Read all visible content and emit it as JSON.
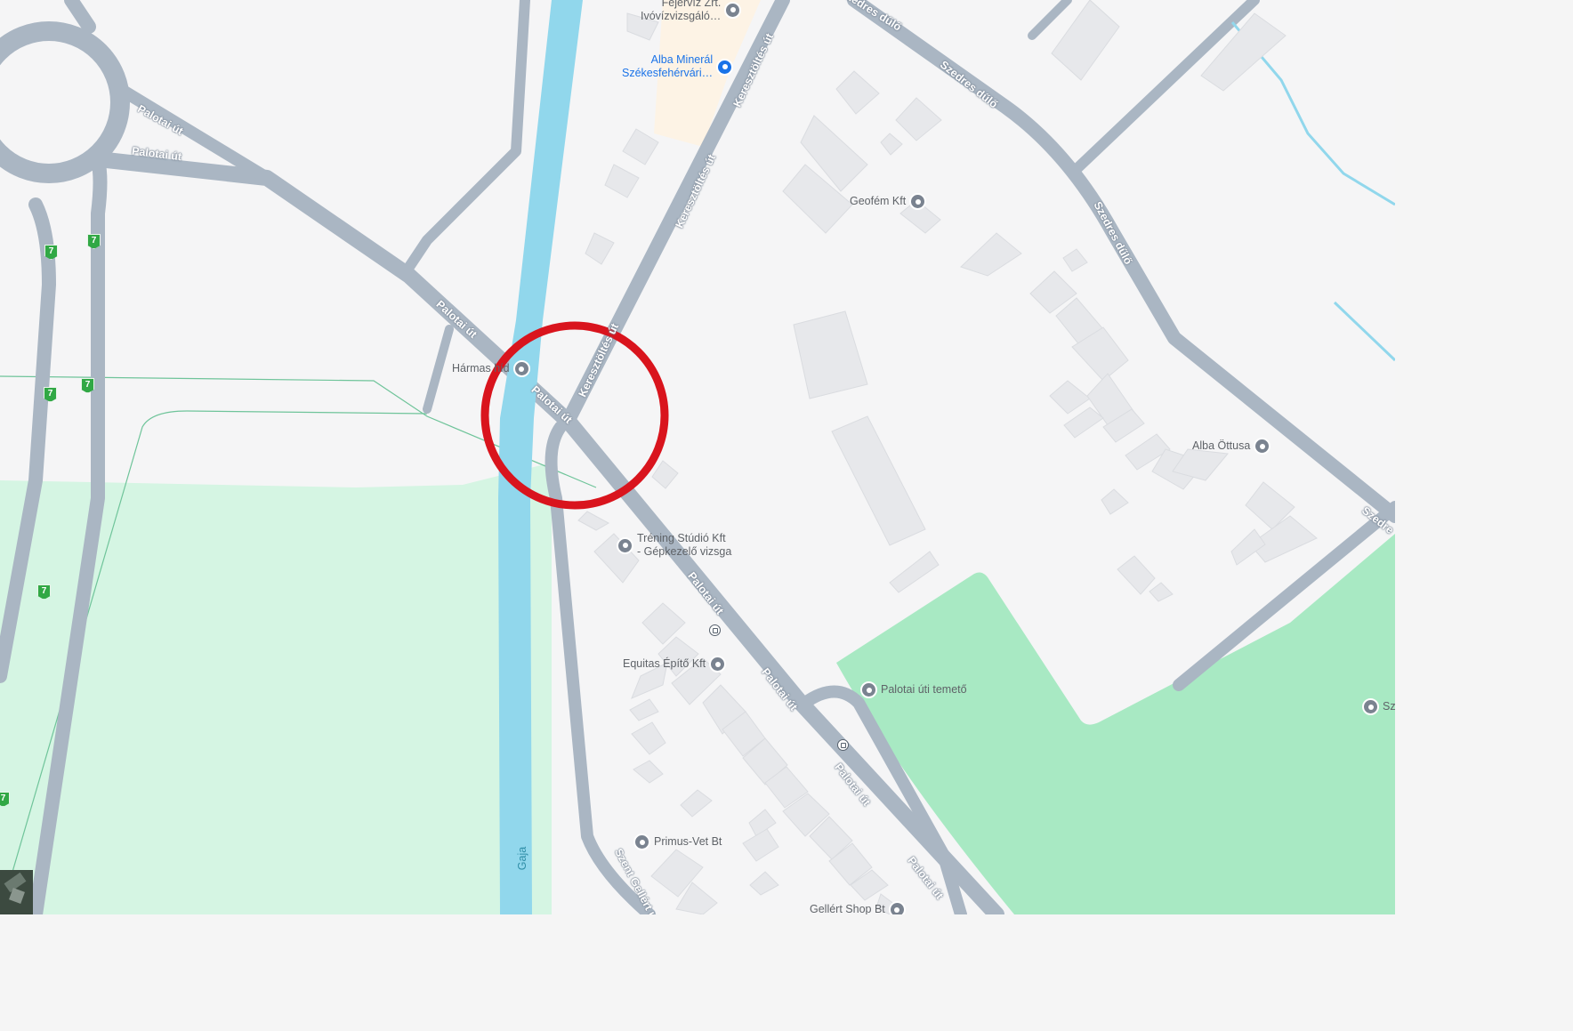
{
  "colors": {
    "background": "#f5f5f6",
    "road": "#aab6c3",
    "water": "#91d7ec",
    "park": "#a8e9c3",
    "park_light": "#d5f5e3",
    "building": "#e7e8eb",
    "highlight_circle": "#d9141d",
    "poi_blue": "#1a73e8",
    "poi_gray": "#7a8390"
  },
  "road_labels": {
    "palotai_1": "Palotai út",
    "palotai_2": "Palotai út",
    "palotai_3": "Palotai út",
    "palotai_4": "Palotai út",
    "palotai_5": "Palotai út",
    "palotai_6": "Palotai út",
    "palotai_7": "Palotai út",
    "palotai_8": "Palotai út",
    "keresztoltes_1": "Keresztöltés út",
    "keresztoltes_2": "Keresztöltés út",
    "keresztoltes_3": "Keresztöltés út",
    "szedres_1": "Szedres dűlő",
    "szedres_2": "Szedres dűlő",
    "szedres_3": "Szedres dűlő",
    "szedres_4": "Szedre",
    "szent_gellert": "Szent Gellért u.",
    "water": "Gaja"
  },
  "route_shields": [
    "7",
    "7",
    "7",
    "7",
    "7",
    "7"
  ],
  "pois": {
    "fejerviz_line1": "Fejérvíz Zrt.",
    "fejerviz_line2": "Ivóvízvizsgáló…",
    "alba_mineral_line1": "Alba Minerál",
    "alba_mineral_line2": "Székesfehérvári…",
    "geofem": "Geofém Kft",
    "harmas": "Hármas híd",
    "trening_line1": "Tréning Stúdió Kft",
    "trening_line2": "- Gépkezelő vizsga",
    "alba_ottusa": "Alba Öttusa",
    "equitas": "Equitas Építő Kft",
    "temeto": "Palotai úti temető",
    "primus": "Primus-Vet Bt",
    "gellert_shop": "Gellért Shop Bt",
    "sz": "Sz"
  },
  "icons": {
    "fejerviz": "museum-icon",
    "alba_mineral": "shopping-cart-icon",
    "harmas": "bridge-icon",
    "trening": "school-icon",
    "temeto": "cemetery-icon",
    "bus": "bus-stop-icon"
  }
}
